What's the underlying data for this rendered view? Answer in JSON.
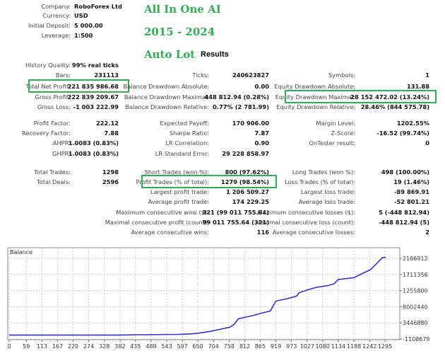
{
  "header": {
    "rows": [
      {
        "label": "Company:",
        "value": "RoboForex Ltd"
      },
      {
        "label": "Currency:",
        "value": "USD"
      },
      {
        "label": "Initial Deposit:",
        "value": "5 000.00"
      },
      {
        "label": "Leverage:",
        "value": "1:500"
      }
    ],
    "brand_lines": [
      "All In One AI",
      "2015 - 2024",
      "Auto Lot"
    ],
    "results_title": "Results",
    "history_quality_label": "History Quality:",
    "history_quality_value": "99% real ticks"
  },
  "highlight_color": "#2fae52",
  "stats": {
    "col1": [
      {
        "label": "Bars:",
        "value": "231113"
      },
      {
        "label": "Total Net Profit:",
        "value": "221 835 986.68",
        "highlight": true
      },
      {
        "label": "Gross Profit:",
        "value": "222 839 209.67"
      },
      {
        "label": "Gross Loss:",
        "value": "-1 003 222.99"
      },
      {
        "label": "Profit Factor:",
        "value": "222.12"
      },
      {
        "label": "Recovery Factor:",
        "value": "7.88"
      },
      {
        "label": "AHPR:",
        "value": "1.0083 (0.83%)"
      },
      {
        "label": "GHPR:",
        "value": "1.0083 (0.83%)"
      },
      {
        "label": "Total Trades:",
        "value": "1298"
      },
      {
        "label": "Total Deals:",
        "value": "2596"
      }
    ],
    "col2": [
      {
        "label": "Ticks:",
        "value": "240623827"
      },
      {
        "label": "Balance Drawdown Absolute:",
        "value": "0.00"
      },
      {
        "label": "Balance Drawdown Maximal:",
        "value": "448 812.94 (0.28%)"
      },
      {
        "label": "Balance Drawdown Relative:",
        "value": "0.77% (2 781.99)"
      },
      {
        "label": "Expected Payoff:",
        "value": "170 906.00"
      },
      {
        "label": "Sharpe Ratio:",
        "value": "7.87"
      },
      {
        "label": "LR Correlation:",
        "value": "0.90"
      },
      {
        "label": "LR Standard Error:",
        "value": "29 228 858.97"
      },
      {
        "label": "Short Trades (won %):",
        "value": "800 (97.62%)"
      },
      {
        "label": "Profit Trades (% of total):",
        "value": "1279 (98.54%)",
        "highlight": true
      },
      {
        "label": "Largest profit trade:",
        "value": "1 206 509.27"
      },
      {
        "label": "Average profit trade:",
        "value": "174 229.25"
      },
      {
        "label": "Maximum consecutive wins ($):",
        "value": "321 (99 011 755.64)"
      },
      {
        "label": "Maximal consecutive profit (count):",
        "value": "99 011 755.64 (321)"
      },
      {
        "label": "Average consecutive wins:",
        "value": "116"
      }
    ],
    "col3": [
      {
        "label": "Symbols:",
        "value": "1"
      },
      {
        "label": "Equity Drawdown Absolute:",
        "value": "131.88"
      },
      {
        "label": "Equity Drawdown Maximal:",
        "value": "28 152 472.02 (13.24%)",
        "highlight": true
      },
      {
        "label": "Equity Drawdown Relative:",
        "value": "28.46% (844 575.78)"
      },
      {
        "label": "Margin Level:",
        "value": "1202.55%"
      },
      {
        "label": "Z-Score:",
        "value": "-16.52 (99.74%)"
      },
      {
        "label": "OnTester result:",
        "value": "0"
      },
      {
        "label": "",
        "value": ""
      },
      {
        "label": "Long Trades (won %):",
        "value": "498 (100.00%)"
      },
      {
        "label": "Loss Trades (% of total):",
        "value": "19 (1.46%)"
      },
      {
        "label": "Largest loss trade:",
        "value": "-89 869.91"
      },
      {
        "label": "Average loss trade:",
        "value": "-52 801.21"
      },
      {
        "label": "Maximum consecutive losses ($):",
        "value": "5 (-448 812.94)"
      },
      {
        "label": "Maximal consecutive loss (count):",
        "value": "-448 812.94 (5)"
      },
      {
        "label": "Average consecutive losses:",
        "value": "2"
      }
    ]
  },
  "chart_data": {
    "type": "line",
    "title": "Balance",
    "line_color": "#3333cc",
    "grid": true,
    "x_ticks": [
      "0",
      "59",
      "113",
      "167",
      "220",
      "274",
      "328",
      "382",
      "435",
      "489",
      "543",
      "597",
      "650",
      "704",
      "758",
      "812",
      "865",
      "919",
      "973",
      "1027",
      "1080",
      "1134",
      "1188",
      "1242",
      "1295"
    ],
    "y_tick_labels": [
      "2166912",
      "1711356",
      "1255800",
      "8002440",
      "3446880",
      "-1108679"
    ],
    "y_tick_values": [
      216691200,
      171135600,
      125580000,
      80024400,
      34468800,
      -11086800
    ],
    "xlim": [
      0,
      1298
    ],
    "ylim": [
      -11086800,
      230000000
    ],
    "series": [
      {
        "x": [
          0,
          380,
          435,
          580,
          620,
          650,
          690,
          720,
          760,
          775,
          790,
          840,
          870,
          900,
          919,
          960,
          990,
          1000,
          1030,
          1060,
          1100,
          1120,
          1134,
          1188,
          1220,
          1245,
          1270,
          1285,
          1298
        ],
        "y": [
          5000,
          100000,
          1000000,
          2000000,
          3000000,
          5000000,
          10000000,
          15000000,
          22000000,
          30000000,
          46000000,
          55000000,
          62000000,
          68000000,
          96000000,
          103000000,
          110000000,
          120000000,
          128000000,
          135000000,
          140000000,
          145000000,
          157000000,
          162000000,
          175000000,
          185000000,
          205000000,
          218000000,
          219500000
        ]
      }
    ]
  }
}
